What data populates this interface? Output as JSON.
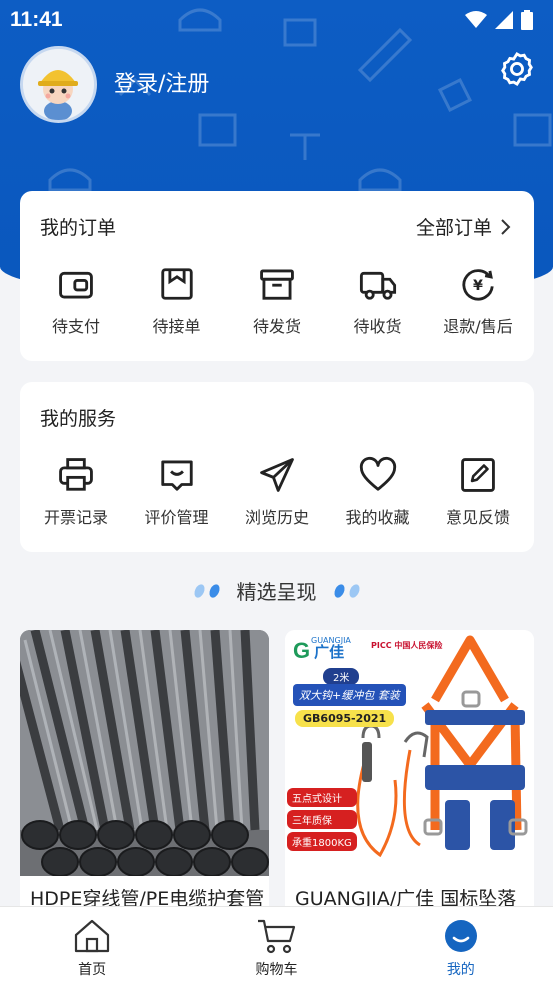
{
  "status_bar": {
    "time": "11:41"
  },
  "profile": {
    "login_label": "登录/注册"
  },
  "orders": {
    "title": "我的订单",
    "all_label": "全部订单",
    "items": [
      {
        "label": "待支付",
        "icon": "wallet-icon"
      },
      {
        "label": "待接单",
        "icon": "inbox-icon"
      },
      {
        "label": "待发货",
        "icon": "box-icon"
      },
      {
        "label": "待收货",
        "icon": "truck-icon"
      },
      {
        "label": "退款/售后",
        "icon": "refund-icon"
      }
    ]
  },
  "services": {
    "title": "我的服务",
    "items": [
      {
        "label": "开票记录",
        "icon": "printer-icon"
      },
      {
        "label": "评价管理",
        "icon": "review-icon"
      },
      {
        "label": "浏览历史",
        "icon": "send-icon"
      },
      {
        "label": "我的收藏",
        "icon": "heart-icon"
      },
      {
        "label": "意见反馈",
        "icon": "edit-icon"
      }
    ]
  },
  "featured": {
    "title": "精选呈现",
    "products": [
      {
        "title": "HDPE穿线管/PE电缆护套管"
      },
      {
        "title": "GUANGJIA/广佳 国标坠落",
        "image_text": {
          "brand": "广佳",
          "brand_latin": "GUANGJIA",
          "insurer": "PICC 中国人民保险",
          "length": "2米",
          "desc": "双大钩+缓冲包 套装",
          "standard": "GB6095-2021",
          "features": [
            "五点式设计",
            "三年质保",
            "承重1800KG"
          ]
        }
      }
    ]
  },
  "bottom_nav": [
    {
      "label": "首页",
      "icon": "home-icon"
    },
    {
      "label": "购物车",
      "icon": "cart-icon"
    },
    {
      "label": "我的",
      "icon": "profile-icon"
    }
  ],
  "colors": {
    "brand_blue": "#0d5dc4",
    "accent": "#1565c0"
  }
}
